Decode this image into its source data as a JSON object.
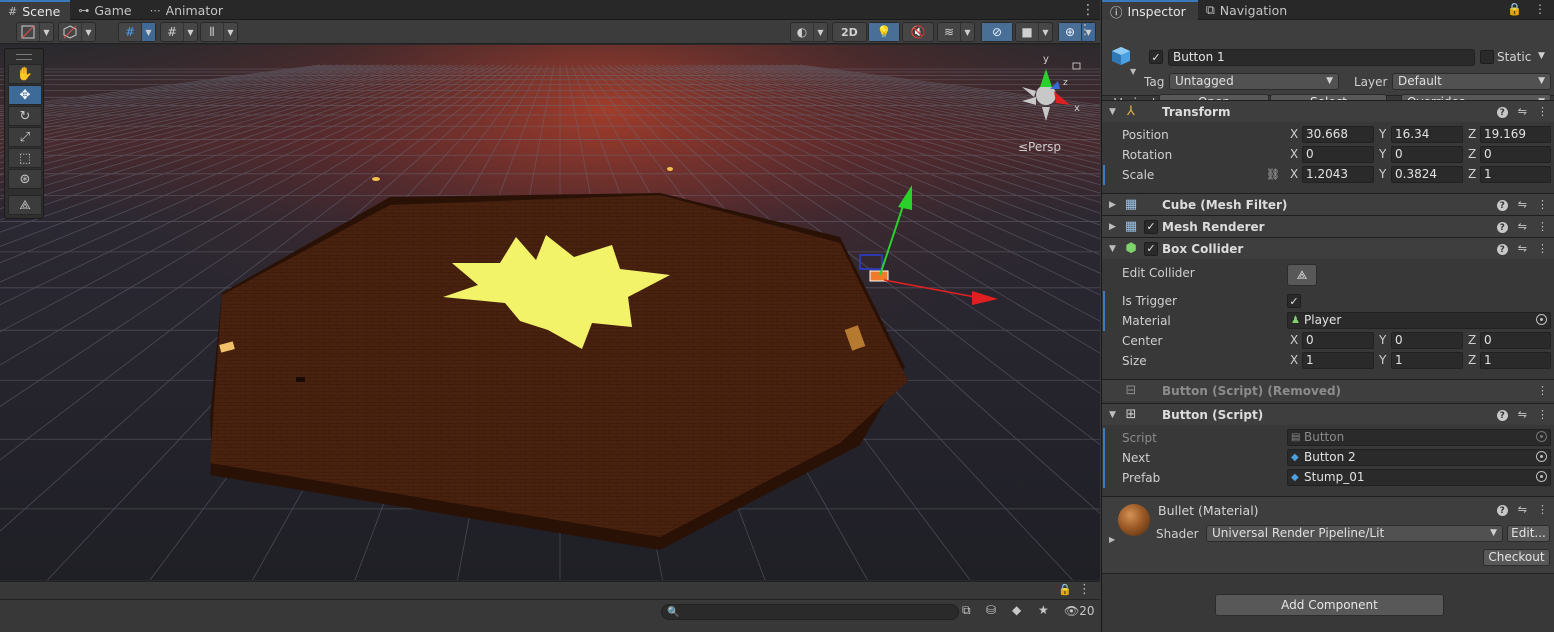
{
  "scene_panel": {
    "tabs": [
      {
        "label": "Scene",
        "icon": "grid-icon"
      },
      {
        "label": "Game",
        "icon": "gamepad-icon"
      },
      {
        "label": "Animator",
        "icon": "animator-icon"
      }
    ],
    "toolbar": {
      "mode_2d": "2D"
    },
    "persp_label": "≤Persp",
    "gizmo_axes": {
      "x": "x",
      "y": "y",
      "z": "z"
    },
    "search_placeholder": "",
    "visible_count": "20"
  },
  "inspector": {
    "tabs": [
      {
        "label": "Inspector",
        "icon": "info-icon"
      },
      {
        "label": "Navigation",
        "icon": "navigation-icon"
      }
    ],
    "gameobject": {
      "name": "Button 1",
      "active": true,
      "static_label": "Static",
      "tag_label": "Tag",
      "tag_value": "Untagged",
      "layer_label": "Layer",
      "layer_value": "Default",
      "variant_label": "Variant",
      "open_label": "Open",
      "select_label": "Select",
      "overrides_label": "Overrides"
    },
    "transform": {
      "title": "Transform",
      "position_label": "Position",
      "rotation_label": "Rotation",
      "scale_label": "Scale",
      "position": {
        "x": "30.668",
        "y": "16.34",
        "z": "19.169"
      },
      "rotation": {
        "x": "0",
        "y": "0",
        "z": "0"
      },
      "scale": {
        "x": "1.2043",
        "y": "0.3824",
        "z": "1"
      }
    },
    "mesh_filter": {
      "title": "Cube (Mesh Filter)"
    },
    "mesh_renderer": {
      "title": "Mesh Renderer",
      "enabled": true
    },
    "box_collider": {
      "title": "Box Collider",
      "enabled": true,
      "edit_collider_label": "Edit Collider",
      "is_trigger_label": "Is Trigger",
      "is_trigger": true,
      "material_label": "Material",
      "material_value": "Player",
      "center_label": "Center",
      "size_label": "Size",
      "center": {
        "x": "0",
        "y": "0",
        "z": "0"
      },
      "size": {
        "x": "1",
        "y": "1",
        "z": "1"
      }
    },
    "button_removed": {
      "title": "Button (Script) (Removed)"
    },
    "button_script": {
      "title": "Button (Script)",
      "script_label": "Script",
      "script_value": "Button",
      "next_label": "Next",
      "next_value": "Button 2",
      "prefab_label": "Prefab",
      "prefab_value": "Stump_01"
    },
    "material": {
      "title": "Bullet (Material)",
      "shader_label": "Shader",
      "shader_value": "Universal Render Pipeline/Lit",
      "edit_label": "Edit...",
      "checkout_label": "Checkout"
    },
    "add_component_label": "Add Component",
    "axis_labels": {
      "x": "X",
      "y": "Y",
      "z": "Z"
    }
  },
  "colors": {
    "accent": "#3a79bb",
    "platform": "#3a1a0c",
    "star": "#f3f36a",
    "gizmo_y": "#2bd12b",
    "gizmo_x": "#e02020"
  }
}
